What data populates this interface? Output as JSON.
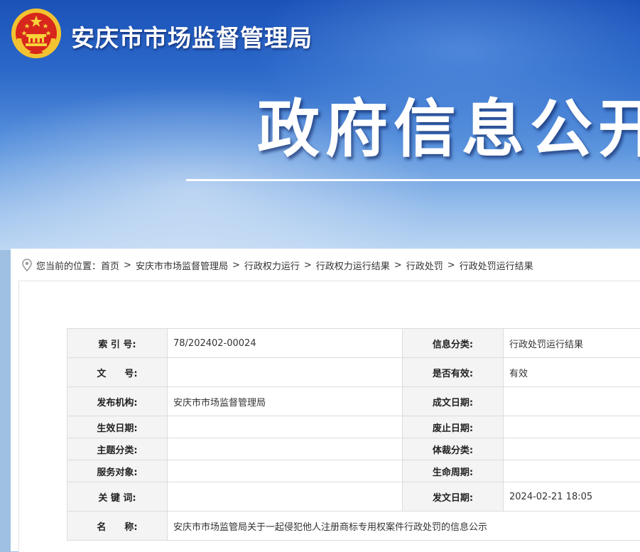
{
  "header": {
    "org_name": "安庆市市场监督管理局",
    "section_title": "政府信息公开",
    "emblem_icon": "national-emblem-icon"
  },
  "breadcrumb": {
    "prefix": "您当前的位置：",
    "items": [
      "首页",
      "安庆市市场监督管理局",
      "行政权力运行",
      "行政权力运行结果",
      "行政处罚",
      "行政处罚运行结果"
    ],
    "separator": ">"
  },
  "meta_table": {
    "rows": [
      {
        "label1": "索 引 号:",
        "value1": "78/202402-00024",
        "label2": "信息分类:",
        "value2": "行政处罚运行结果"
      },
      {
        "label1": "文　　号:",
        "value1": "",
        "label2": "是否有效:",
        "value2": "有效"
      },
      {
        "label1": "发布机构:",
        "value1": "安庆市市场监督管理局",
        "label2": "成文日期:",
        "value2": ""
      },
      {
        "label1": "生效日期:",
        "value1": "",
        "label2": "废止日期:",
        "value2": ""
      },
      {
        "label1": "主题分类:",
        "value1": "",
        "label2": "体裁分类:",
        "value2": ""
      },
      {
        "label1": "服务对象:",
        "value1": "",
        "label2": "生命周期:",
        "value2": ""
      },
      {
        "label1": "关 键 词:",
        "value1": "",
        "label2": "发文日期:",
        "value2": "2024-02-21 18:05"
      }
    ],
    "name_label": "名　　称:",
    "name_value": "安庆市市场监管局关于一起侵犯他人注册商标专用权案件行政处罚的信息公示"
  },
  "colors": {
    "banner_top": "#1b52b8",
    "banner_bottom": "#bcd6f3",
    "label_bg": "#f4f4f4",
    "border": "#dcdcdc"
  }
}
